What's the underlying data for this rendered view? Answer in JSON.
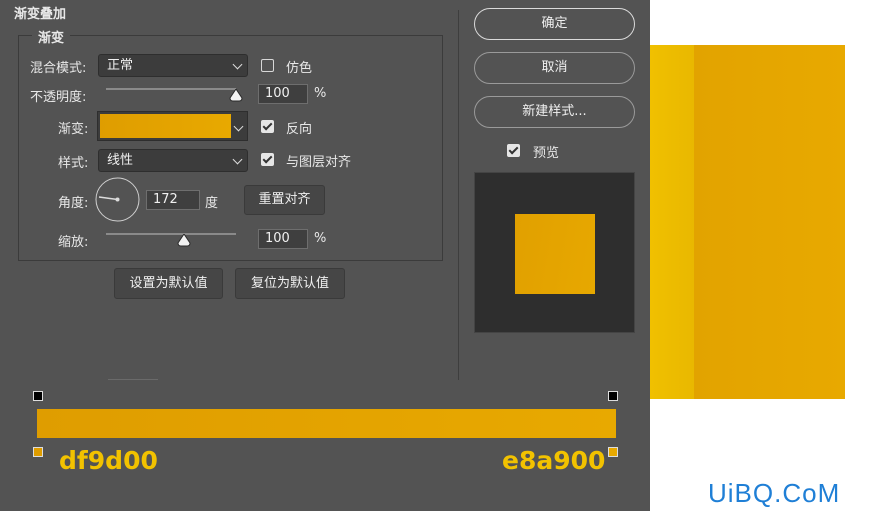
{
  "dialog": {
    "section_title": "渐变叠加",
    "group_title": "渐变",
    "blend_mode_label": "混合模式:",
    "blend_mode_value": "正常",
    "dither_label": "仿色",
    "dither_checked": false,
    "opacity_label": "不透明度:",
    "opacity_value": "100",
    "opacity_unit": "%",
    "opacity_level_percent": 100,
    "gradient_label": "渐变:",
    "reverse_label": "反向",
    "reverse_checked": true,
    "style_label": "样式:",
    "style_value": "线性",
    "align_label": "与图层对齐",
    "align_checked": true,
    "angle_label": "角度:",
    "angle_value": "172",
    "angle_unit": "度",
    "reset_align_button": "重置对齐",
    "scale_label": "缩放:",
    "scale_value": "100",
    "scale_unit": "%",
    "set_default_button": "设置为默认值",
    "reset_default_button": "复位为默认值"
  },
  "actions": {
    "ok_button": "确定",
    "cancel_button": "取消",
    "new_style_button": "新建样式...",
    "preview_label": "预览",
    "preview_checked": true
  },
  "gradient_editor": {
    "start_color_label": "df9d00",
    "end_color_label": "e8a900"
  },
  "colors": {
    "panel_bg": "#535353",
    "gradient_start": "#df9d00",
    "gradient_end": "#e8a900",
    "label_yellow": "#f2c200",
    "canvas_stripe": "#eec000",
    "canvas_fill": "#e4a500"
  },
  "watermark": "UiBQ.CoM"
}
